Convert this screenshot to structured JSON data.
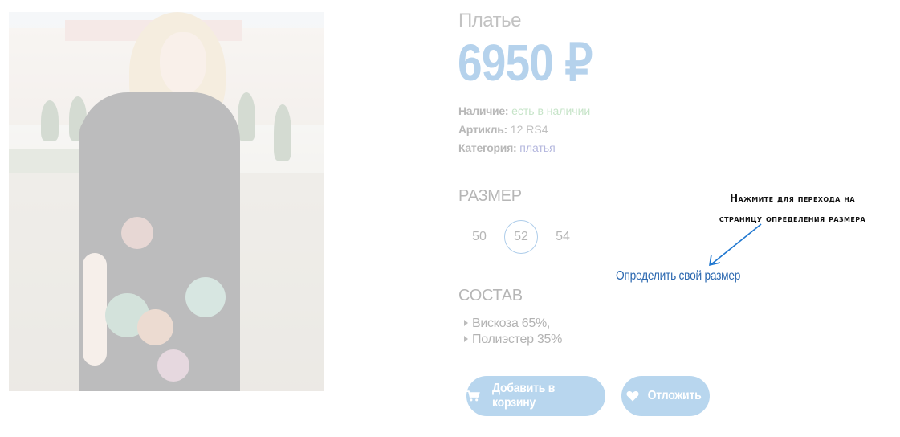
{
  "product": {
    "title": "Платье",
    "price": "6950 ₽"
  },
  "meta": {
    "stock_label": "Наличие:",
    "stock_value": "есть в наличии",
    "sku_label": "Артикль:",
    "sku_value": "12 RS4",
    "category_label": "Категория:",
    "category_value": "платья"
  },
  "size": {
    "title": "РАЗМЕР",
    "options": [
      "50",
      "52",
      "54"
    ],
    "selected": "52",
    "find_link": "Определить свой размер"
  },
  "hint": {
    "line1": "Нажмите для перехода на",
    "line2": "страницу определения размера"
  },
  "composition": {
    "title": "СОСТАВ",
    "items": [
      "Вискоза 65%,",
      "Полиэстер 35%"
    ]
  },
  "buttons": {
    "cart_label": "Добавить в корзину",
    "cart_icon": "cart-icon",
    "later_label": "Отложить",
    "later_icon": "heart-icon"
  },
  "colors": {
    "accent": "#b8d6ee",
    "link": "#2b68b0",
    "arrow": "#1f77d0"
  }
}
